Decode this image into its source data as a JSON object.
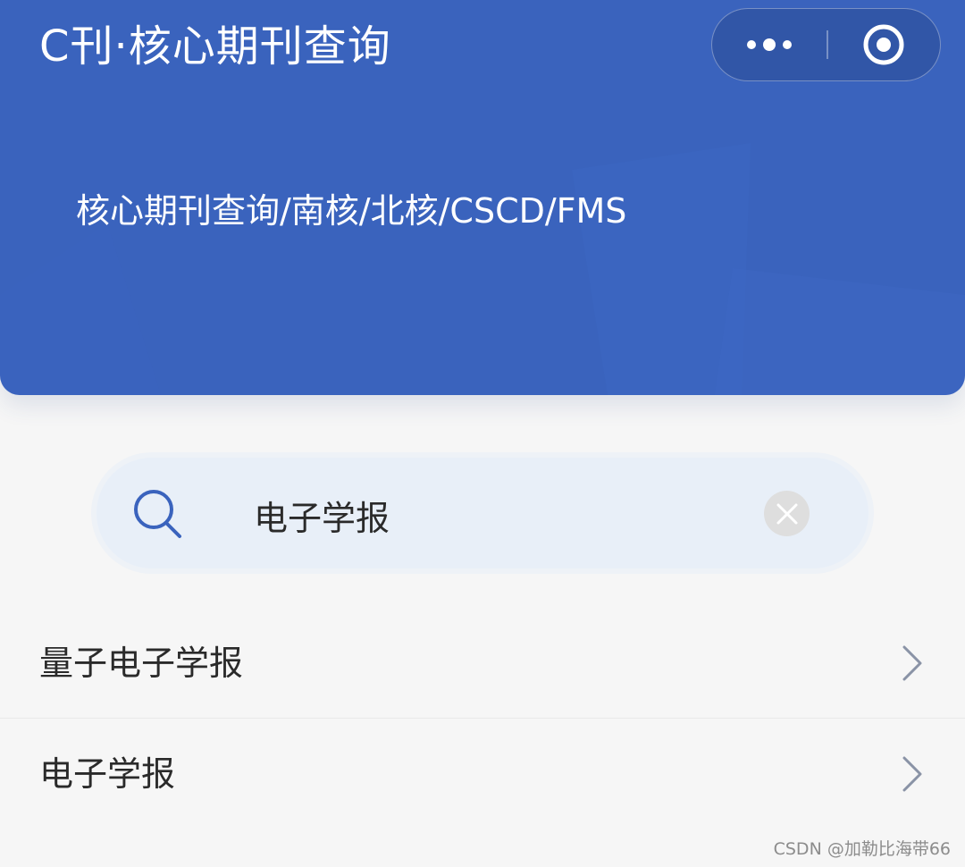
{
  "header": {
    "title": "C刊·核心期刊查询",
    "subtitle": "核心期刊查询/南核/北核/CSCD/FMS",
    "background_color": "#3a63bd",
    "capsule": {
      "more_icon": "more-dots-icon",
      "close_icon": "target-circle-icon"
    }
  },
  "search": {
    "query": "电子学报",
    "search_icon": "search-icon",
    "clear_icon": "clear-x-icon",
    "accent_color": "#3a63bd"
  },
  "results": [
    {
      "label": "量子电子学报"
    },
    {
      "label": "电子学报"
    }
  ],
  "watermark": "CSDN @加勒比海带66"
}
